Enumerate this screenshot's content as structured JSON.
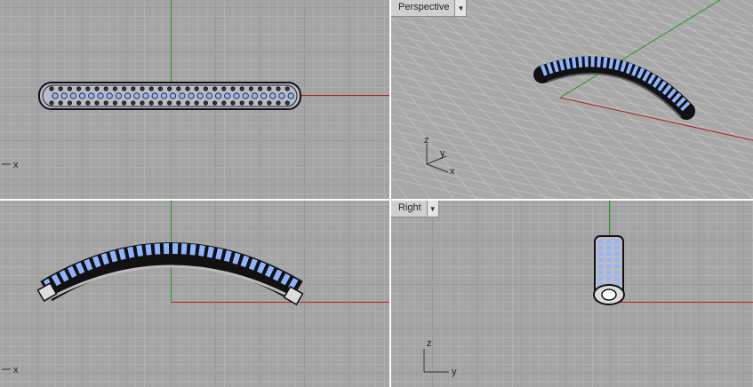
{
  "viewports": {
    "top": {
      "axis_label_x": "x"
    },
    "perspective": {
      "title": "Perspective",
      "axis_labels": {
        "z": "z",
        "y": "y",
        "x": "x"
      }
    },
    "front": {
      "axis_label_x": "x"
    },
    "right": {
      "title": "Right",
      "axis_labels": {
        "z": "z",
        "y": "y"
      }
    }
  },
  "colors": {
    "grid_background": "#a4a4a4",
    "axis_x": "#b52020",
    "axis_y": "#1e9a1e",
    "gem": "#8fb4ff",
    "metal": "#1c1c1c"
  }
}
